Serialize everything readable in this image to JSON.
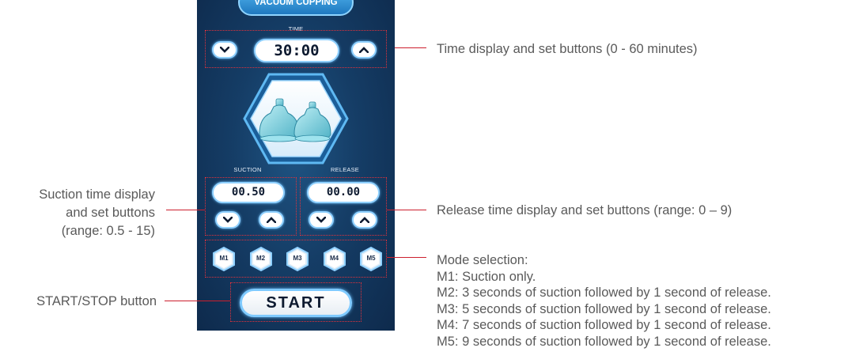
{
  "panel": {
    "title": "VACUUM CUPPING",
    "time_label": "TIME",
    "time_value": "30:00",
    "suction_label": "SUCTION",
    "suction_value": "00.50",
    "release_label": "RELEASE",
    "release_value": "00.00",
    "modes": [
      "M1",
      "M2",
      "M3",
      "M4",
      "M5"
    ],
    "start_label": "START"
  },
  "annotations": {
    "time": "Time display and set buttons (0 - 60 minutes)",
    "suction_line1": "Suction time display",
    "suction_line2": "and set buttons",
    "suction_line3": "(range: 0.5 - 15)",
    "release": "Release time display and set buttons (range: 0 – 9)",
    "mode_lines": [
      "Mode selection:",
      "M1: Suction only.",
      "M2: 3 seconds of suction followed by 1 second of release.",
      "M3: 5 seconds of suction followed by 1 second of release.",
      "M4: 7 seconds of suction followed by 1 second of release.",
      "M5: 9 seconds of suction followed by 1 second of release."
    ],
    "start": "START/STOP button"
  },
  "colors": {
    "panel_bg": "#153d66",
    "accent": "#8fd0ff",
    "leader_line": "#cc1f2d",
    "annotation_text": "#5a5a5a"
  }
}
